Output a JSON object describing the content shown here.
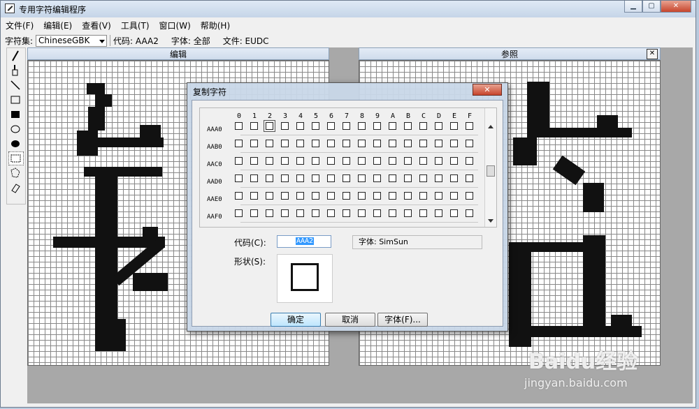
{
  "window": {
    "title": "专用字符编辑程序"
  },
  "menu": [
    "文件(F)",
    "编辑(E)",
    "查看(V)",
    "工具(T)",
    "窗口(W)",
    "帮助(H)"
  ],
  "toolbar": {
    "charset_label": "字符集:",
    "charset_value": "ChineseGBK",
    "code_info": "代码: AAA2",
    "font_info": "字体: 全部",
    "file_info": "文件: EUDC"
  },
  "panes": {
    "edit_title": "编辑",
    "ref_title": "参照",
    "ref_close": "✕"
  },
  "dialog": {
    "title": "复制字符",
    "close": "✕",
    "columns": [
      "0",
      "1",
      "2",
      "3",
      "4",
      "5",
      "6",
      "7",
      "8",
      "9",
      "A",
      "B",
      "C",
      "D",
      "E",
      "F"
    ],
    "rows": [
      "AAA0",
      "AAB0",
      "AAC0",
      "AAD0",
      "AAE0",
      "AAF0"
    ],
    "code_label": "代码(C):",
    "code_value": "AAA2",
    "shape_label": "形状(S):",
    "font_display": "字体:    SimSun",
    "ok": "确定",
    "cancel": "取消",
    "font_button": "字体(F)..."
  },
  "watermark": {
    "logo": "Baidu经验",
    "url": "jingyan.baidu.com"
  }
}
